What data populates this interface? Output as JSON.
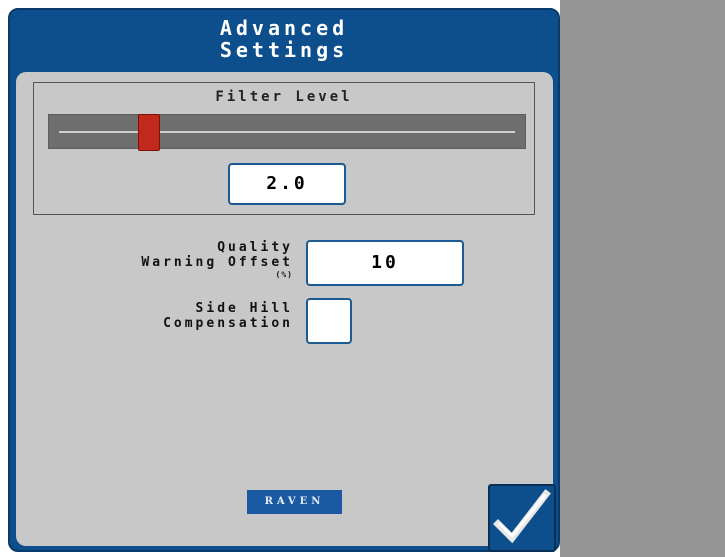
{
  "dialog": {
    "title_line1": "Advanced",
    "title_line2": "Settings"
  },
  "filter": {
    "label": "Filter Level",
    "value_text": "2.0",
    "slider_fraction": 0.21
  },
  "quality_offset": {
    "label_line1": "Quality",
    "label_line2": "Warning Offset",
    "label_unit": "(%)",
    "value": "10"
  },
  "side_hill": {
    "label_line1": "Side Hill",
    "label_line2": "Compensation",
    "checked": false
  },
  "logo": {
    "text": "RAVEN"
  },
  "icons": {
    "confirm": "checkmark-icon"
  },
  "colors": {
    "panel": "#0d4f8d",
    "body": "#c8c8c8",
    "slider_thumb": "#c0291c",
    "side_panel": "#959595"
  }
}
